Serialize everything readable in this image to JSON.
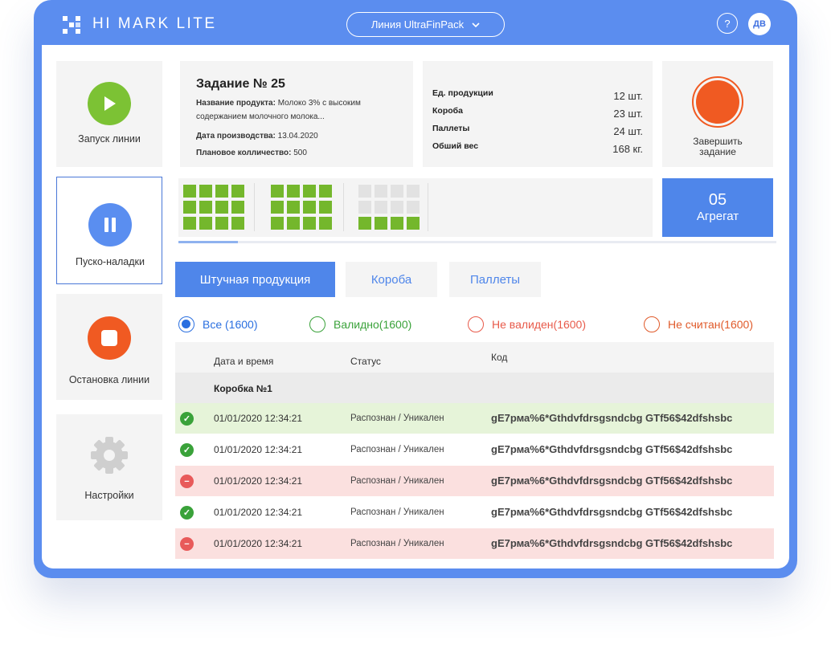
{
  "header": {
    "brand": "HI MARK LITE",
    "line_selector": "Линия UltraFinPack",
    "help_label": "?",
    "user_initials": "ДВ"
  },
  "colors": {
    "primary": "#4f86ea",
    "frame": "#5b8def",
    "start": "#7cc234",
    "pause": "#5a8ef0",
    "stop": "#f05a22",
    "valid": "#3aa23a",
    "invalid": "#e85a4a",
    "not_read": "#e05a2a"
  },
  "sidebar": {
    "items": [
      {
        "label": "Запуск линии",
        "icon": "play-icon"
      },
      {
        "label": "Пуско-наладки",
        "icon": "pause-icon"
      },
      {
        "label": "Остановка линии",
        "icon": "stop-icon"
      },
      {
        "label": "Настройки",
        "icon": "gear-icon"
      }
    ]
  },
  "task": {
    "title": "Задание № 25",
    "product_label": "Название продукта:",
    "product_value_line1": "Молоко 3% с высоким",
    "product_value_line2": "содержанием молочного молока...",
    "date_label": "Дата производства:",
    "date_value": "13.04.2020",
    "planned_label": "Плановое колличество:",
    "planned_value": "500"
  },
  "stats": [
    {
      "label": "Ед. продукции",
      "value": "12 шт."
    },
    {
      "label": "Короба",
      "value": "23 шт."
    },
    {
      "label": "Паллеты",
      "value": "24 шт."
    },
    {
      "label": "Обший вес",
      "value": "168 кг."
    }
  ],
  "finish": {
    "label_line1": "Завершить",
    "label_line2": "задание"
  },
  "aggregate": {
    "number": "05",
    "label": "Агрегат"
  },
  "grid_fill": [
    12,
    12,
    4
  ],
  "progress": 0.1,
  "tabs": [
    {
      "label": "Штучная продукция",
      "active": true
    },
    {
      "label": "Короба",
      "active": false
    },
    {
      "label": "Паллеты",
      "active": false
    }
  ],
  "filters": [
    {
      "label": "Все (1600)",
      "selected": true
    },
    {
      "label": "Валидно(1600)",
      "selected": false
    },
    {
      "label": "Не валиден(1600)",
      "selected": false
    },
    {
      "label": "Не считан(1600)",
      "selected": false
    }
  ],
  "table": {
    "columns": [
      "Дата и время",
      "Статус",
      "Код"
    ],
    "group": "Коробка №1",
    "rows": [
      {
        "state": "valid",
        "datetime": "01/01/2020 12:34:21",
        "status": "Распознан / Уникален",
        "code": "gE7рма%6*Gthdvfdrsgsndcbg GTf56$42dfshsbc"
      },
      {
        "state": "valid",
        "datetime": "01/01/2020 12:34:21",
        "status": "Распознан / Уникален",
        "code": "gE7рма%6*Gthdvfdrsgsndcbg GTf56$42dfshsbc"
      },
      {
        "state": "invalid",
        "datetime": "01/01/2020 12:34:21",
        "status": "Распознан / Уникален",
        "code": "gE7рма%6*Gthdvfdrsgsndcbg GTf56$42dfshsbc"
      },
      {
        "state": "valid",
        "datetime": "01/01/2020 12:34:21",
        "status": "Распознан / Уникален",
        "code": "gE7рма%6*Gthdvfdrsgsndcbg GTf56$42dfshsbc"
      },
      {
        "state": "invalid",
        "datetime": "01/01/2020 12:34:21",
        "status": "Распознан / Уникален",
        "code": "gE7рма%6*Gthdvfdrsgsndcbg GTf56$42dfshsbc"
      }
    ]
  }
}
